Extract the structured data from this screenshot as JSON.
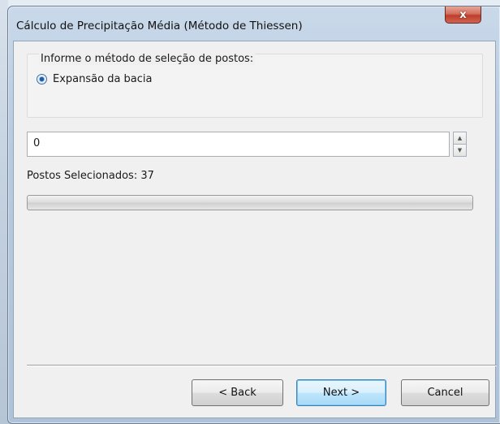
{
  "window": {
    "title": "Cálculo de Precipitação Média (Método de Thiessen)",
    "close_glyph": "x"
  },
  "selection_group": {
    "label": "Informe o método de seleção de postos:",
    "radio_option": {
      "label": "Expansão da bacia",
      "checked": true
    }
  },
  "spin_input": {
    "value": "0",
    "up_glyph": "▲",
    "down_glyph": "▼"
  },
  "selected_stations": {
    "text": "Postos Selecionados: 37"
  },
  "progress": {
    "value": 0
  },
  "buttons": {
    "back": "< Back",
    "next": "Next >",
    "cancel": "Cancel"
  },
  "colors": {
    "client_bg": "#f0f0f0",
    "close_button": "#c8493a",
    "default_button_border": "#3c7fb1"
  }
}
